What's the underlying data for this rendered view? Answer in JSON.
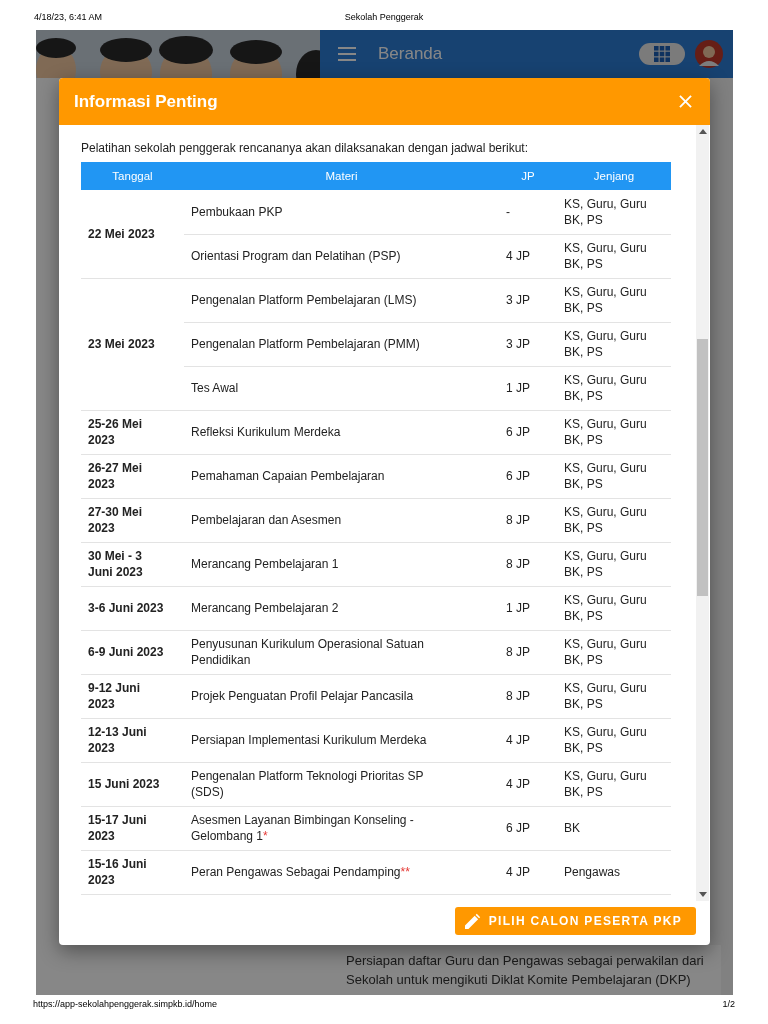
{
  "print_header": {
    "datetime": "4/18/23, 6:41 AM",
    "title": "Sekolah Penggerak"
  },
  "app_bar": {
    "title": "Beranda"
  },
  "background_card": {
    "text": "Persiapan daftar Guru dan Pengawas sebagai perwakilan dari Sekolah untuk mengikuti Diklat Komite Pembelajaran (DKP)"
  },
  "dialog": {
    "title": "Informasi Penting",
    "intro": "Pelatihan sekolah penggerak rencananya akan dilaksanakan dengan jadwal berikut:",
    "table": {
      "columns": [
        "Tanggal",
        "Materi",
        "JP",
        "Jenjang"
      ],
      "groups": [
        {
          "date": "22 Mei 2023",
          "rows": [
            {
              "materi": "Pembukaan PKP",
              "jp": "-",
              "jenjang": "KS, Guru, Guru BK, PS"
            },
            {
              "materi": "Orientasi Program dan Pelatihan (PSP)",
              "jp": "4 JP",
              "jenjang": "KS, Guru, Guru BK, PS"
            }
          ]
        },
        {
          "date": "23 Mei 2023",
          "rows": [
            {
              "materi": "Pengenalan Platform Pembelajaran (LMS)",
              "jp": "3 JP",
              "jenjang": "KS, Guru, Guru BK, PS"
            },
            {
              "materi": "Pengenalan Platform Pembelajaran (PMM)",
              "jp": "3 JP",
              "jenjang": "KS, Guru, Guru BK, PS"
            },
            {
              "materi": "Tes Awal",
              "jp": "1 JP",
              "jenjang": "KS, Guru, Guru BK, PS"
            }
          ]
        },
        {
          "date": "25-26 Mei 2023",
          "rows": [
            {
              "materi": "Refleksi Kurikulum Merdeka",
              "jp": "6 JP",
              "jenjang": "KS, Guru, Guru BK, PS"
            }
          ]
        },
        {
          "date": "26-27 Mei 2023",
          "rows": [
            {
              "materi": "Pemahaman Capaian Pembelajaran",
              "jp": "6 JP",
              "jenjang": "KS, Guru, Guru BK, PS"
            }
          ]
        },
        {
          "date": "27-30 Mei 2023",
          "rows": [
            {
              "materi": "Pembelajaran dan Asesmen",
              "jp": "8 JP",
              "jenjang": "KS, Guru, Guru BK, PS"
            }
          ]
        },
        {
          "date": "30 Mei - 3 Juni 2023",
          "rows": [
            {
              "materi": "Merancang Pembelajaran 1",
              "jp": "8 JP",
              "jenjang": "KS, Guru, Guru BK, PS"
            }
          ]
        },
        {
          "date": "3-6 Juni 2023",
          "rows": [
            {
              "materi": "Merancang Pembelajaran 2",
              "jp": "1 JP",
              "jenjang": "KS, Guru, Guru BK, PS"
            }
          ]
        },
        {
          "date": "6-9 Juni 2023",
          "rows": [
            {
              "materi": "Penyusunan Kurikulum Operasional Satuan Pendidikan",
              "jp": "8 JP",
              "jenjang": "KS, Guru, Guru BK, PS"
            }
          ]
        },
        {
          "date": "9-12 Juni 2023",
          "rows": [
            {
              "materi": "Projek Penguatan Profil Pelajar Pancasila",
              "jp": "8 JP",
              "jenjang": "KS, Guru, Guru BK, PS"
            }
          ]
        },
        {
          "date": "12-13 Juni 2023",
          "rows": [
            {
              "materi": "Persiapan Implementasi Kurikulum Merdeka",
              "jp": "4 JP",
              "jenjang": "KS, Guru, Guru BK, PS"
            }
          ]
        },
        {
          "date": "15 Juni 2023",
          "rows": [
            {
              "materi": "Pengenalan Platform Teknologi Prioritas SP (SDS)",
              "jp": "4 JP",
              "jenjang": "KS, Guru, Guru BK, PS"
            }
          ]
        },
        {
          "date": "15-17 Juni 2023",
          "rows": [
            {
              "materi": "Asesmen Layanan Bimbingan Konseling - Gelombang 1",
              "note": "*",
              "jp": "6 JP",
              "jenjang": "BK"
            }
          ]
        },
        {
          "date": "15-16 Juni 2023",
          "rows": [
            {
              "materi": "Peran Pengawas Sebagai Pendamping",
              "note": "**",
              "jp": "4 JP",
              "jenjang": "Pengawas"
            }
          ]
        }
      ]
    },
    "button": "PILIH CALON PESERTA PKP"
  },
  "print_footer": {
    "url": "https://app-sekolahpenggerak.simpkb.id/home",
    "page": "1/2"
  }
}
